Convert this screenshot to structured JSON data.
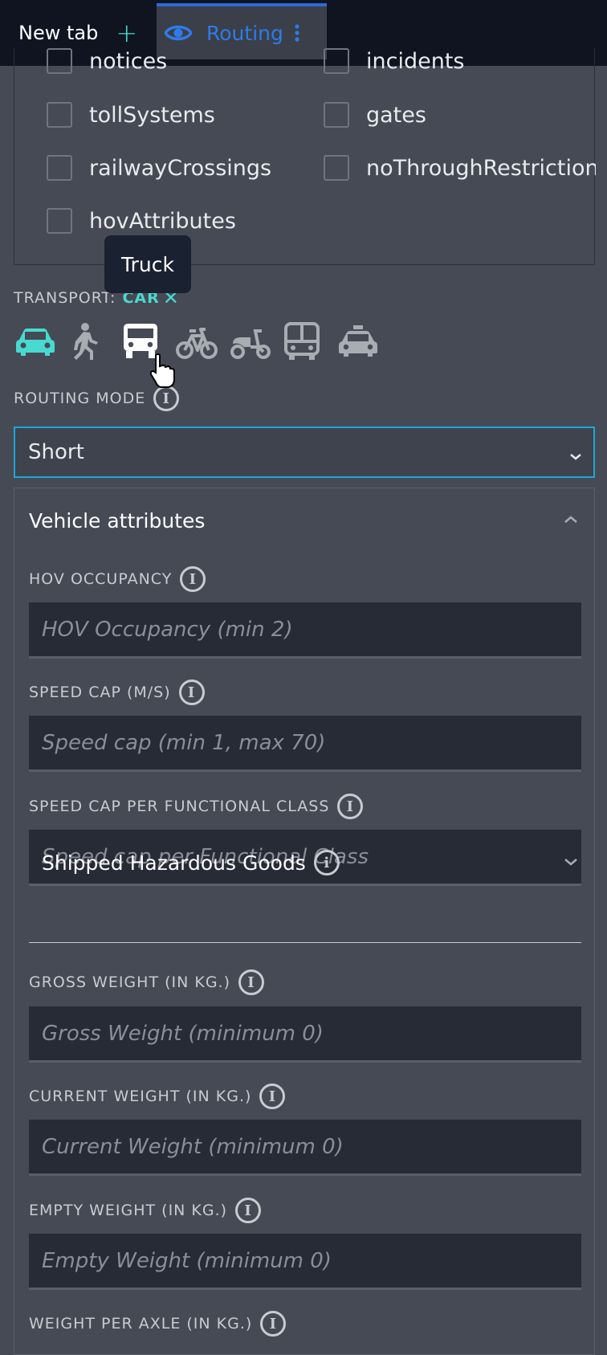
{
  "tabs": {
    "new_tab_label": "New tab",
    "new_tab_plus": "+",
    "active_tab_label": "Routing"
  },
  "feature_checkboxes": [
    {
      "label": "notices",
      "checked": false
    },
    {
      "label": "incidents",
      "checked": false
    },
    {
      "label": "tollSystems",
      "checked": false
    },
    {
      "label": "gates",
      "checked": false
    },
    {
      "label": "railwayCrossings",
      "checked": false
    },
    {
      "label": "noThroughRestrictions",
      "checked": false
    },
    {
      "label": "hovAttributes",
      "checked": false
    }
  ],
  "tooltip": {
    "text": "Truck"
  },
  "transport": {
    "label": "TRANSPORT:",
    "value": "CAR",
    "modes": [
      "car",
      "pedestrian",
      "truck",
      "bicycle",
      "scooter",
      "bus",
      "taxi"
    ],
    "selected": "car",
    "hovered": "truck"
  },
  "routing_mode": {
    "label": "ROUTING MODE",
    "value": "Short"
  },
  "vehicle_attributes": {
    "title": "Vehicle attributes",
    "hov_occupancy": {
      "label": "HOV OCCUPANCY",
      "placeholder": "HOV Occupancy (min 2)"
    },
    "speed_cap": {
      "label": "SPEED CAP (M/S)",
      "placeholder": "Speed cap (min 1, max 70)"
    },
    "speed_cap_fc": {
      "label": "SPEED CAP PER FUNCTIONAL CLASS",
      "placeholder": "Speed cap per Functional Class"
    },
    "hazardous_goods": {
      "label": "Shipped Hazardous Goods"
    },
    "gross_weight": {
      "label": "GROSS WEIGHT (IN KG.)",
      "placeholder": "Gross Weight (minimum 0)"
    },
    "current_weight": {
      "label": "CURRENT WEIGHT (IN KG.)",
      "placeholder": "Current Weight (minimum 0)"
    },
    "empty_weight": {
      "label": "EMPTY WEIGHT (IN KG.)",
      "placeholder": "Empty Weight (minimum 0)"
    },
    "weight_per_axle": {
      "label": "WEIGHT PER AXLE (IN KG.)"
    }
  },
  "colors": {
    "accent": "#48dad0",
    "tab_active": "#2f7be6",
    "select_border": "#1aa8d8",
    "background": "#464a55",
    "topbar": "#0f1420"
  }
}
